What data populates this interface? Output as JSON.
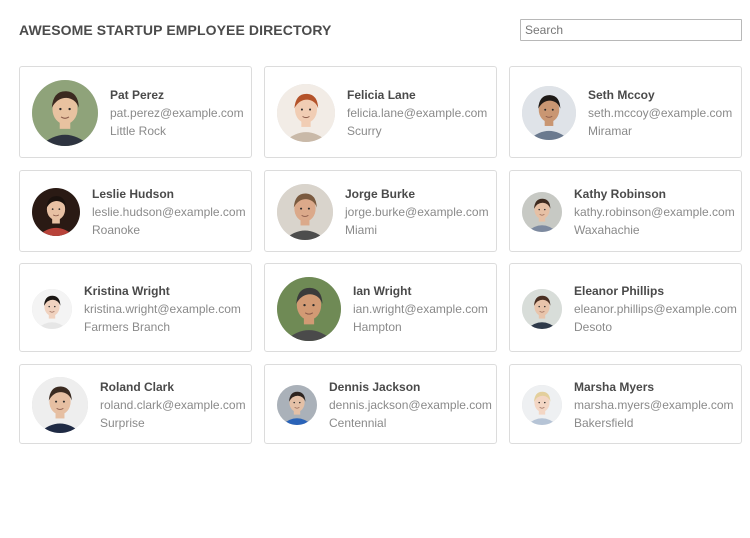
{
  "header": {
    "title": "AWESOME STARTUP EMPLOYEE DIRECTORY",
    "search_placeholder": "Search",
    "search_value": ""
  },
  "employees": [
    {
      "name": "Pat Perez",
      "email": "pat.perez@example.com",
      "city": "Little Rock",
      "photo": {
        "bg": "#8fa37a",
        "skin": "#e8c2a0",
        "hair": "#3b2a20",
        "shirt": "#2e3440"
      }
    },
    {
      "name": "Felicia Lane",
      "email": "felicia.lane@example.com",
      "city": "Scurry",
      "photo": {
        "bg": "#f2ece6",
        "skin": "#f1cdb4",
        "hair": "#b4532a",
        "shirt": "#c9b9a8"
      }
    },
    {
      "name": "Seth Mccoy",
      "email": "seth.mccoy@example.com",
      "city": "Miramar",
      "photo": {
        "bg": "#dfe3e8",
        "skin": "#c99672",
        "hair": "#1e1a17",
        "shirt": "#6b7a8f"
      }
    },
    {
      "name": "Leslie Hudson",
      "email": "leslie.hudson@example.com",
      "city": "Roanoke",
      "photo": {
        "bg": "#2a1a14",
        "skin": "#e7c0a3",
        "hair": "#1b120e",
        "shirt": "#b8433a"
      }
    },
    {
      "name": "Jorge Burke",
      "email": "jorge.burke@example.com",
      "city": "Miami",
      "photo": {
        "bg": "#d9d4cc",
        "skin": "#dba98a",
        "hair": "#7a5a3f",
        "shirt": "#4d4d4d"
      }
    },
    {
      "name": "Kathy Robinson",
      "email": "kathy.robinson@example.com",
      "city": "Waxahachie",
      "photo": {
        "bg": "#c7c9c4",
        "skin": "#e6c0a5",
        "hair": "#3e2a1f",
        "shirt": "#7d8aa0"
      }
    },
    {
      "name": "Kristina Wright",
      "email": "kristina.wright@example.com",
      "city": "Farmers Branch",
      "photo": {
        "bg": "#f4f4f4",
        "skin": "#f0d2bf",
        "hair": "#1c1714",
        "shirt": "#e6e6e6"
      }
    },
    {
      "name": "Ian Wright",
      "email": "ian.wright@example.com",
      "city": "Hampton",
      "photo": {
        "bg": "#6f8a55",
        "skin": "#d29a74",
        "hair": "#3b3b3b",
        "shirt": "#4a4a4a"
      }
    },
    {
      "name": "Eleanor Phillips",
      "email": "eleanor.phillips@example.com",
      "city": "Desoto",
      "photo": {
        "bg": "#d8ddd9",
        "skin": "#e8c4ab",
        "hair": "#4a2f22",
        "shirt": "#2f3a4a"
      }
    },
    {
      "name": "Roland Clark",
      "email": "roland.clark@example.com",
      "city": "Surprise",
      "photo": {
        "bg": "#eeeeee",
        "skin": "#e6bfa2",
        "hair": "#3a2a20",
        "shirt": "#1f2a44"
      }
    },
    {
      "name": "Dennis Jackson",
      "email": "dennis.jackson@example.com",
      "city": "Centennial",
      "photo": {
        "bg": "#aab1b9",
        "skin": "#e4c0a6",
        "hair": "#2d2420",
        "shirt": "#2a63b8"
      }
    },
    {
      "name": "Marsha Myers",
      "email": "marsha.myers@example.com",
      "city": "Bakersfield",
      "photo": {
        "bg": "#eef0f2",
        "skin": "#f3d6c4",
        "hair": "#e3cf9c",
        "shirt": "#b6c4d6"
      }
    }
  ]
}
